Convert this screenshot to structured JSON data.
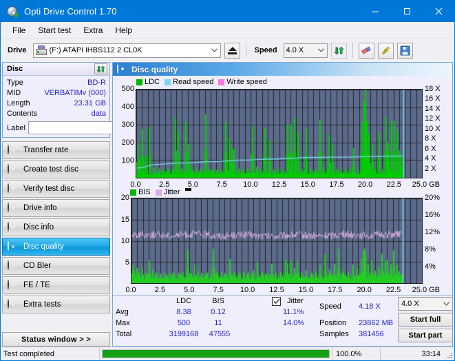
{
  "window": {
    "title": "Opti Drive Control 1.70",
    "icon": "disc-drive-icon",
    "minimize_label": "–",
    "maximize_label": "□",
    "close_label": "✕"
  },
  "menu": {
    "items": [
      {
        "label": "File",
        "name": "menu-file"
      },
      {
        "label": "Start test",
        "name": "menu-start-test"
      },
      {
        "label": "Extra",
        "name": "menu-extra"
      },
      {
        "label": "Help",
        "name": "menu-help"
      }
    ]
  },
  "toolbar": {
    "drive_label": "Drive",
    "drive_value": "(F:)  ATAPI iHBS112  2 CL0K",
    "eject_title": "Eject",
    "speed_label": "Speed",
    "speed_value": "4.0 X",
    "refresh_title": "Refresh",
    "erase_title": "Erase",
    "bitsetting_title": "Bitsetting",
    "save_title": "Save"
  },
  "sidebar": {
    "disc": {
      "title": "Disc",
      "refresh_title": "Refresh disc info",
      "rows": [
        {
          "key": "Type",
          "value": "BD-R"
        },
        {
          "key": "MID",
          "value": "VERBATIMv (000)"
        },
        {
          "key": "Length",
          "value": "23.31 GB"
        },
        {
          "key": "Contents",
          "value": "data"
        }
      ],
      "label_key": "Label",
      "label_value": "",
      "label_placeholder": "",
      "label_button_title": "Disc label"
    },
    "nav": [
      {
        "label": "Transfer rate",
        "name": "sidebar-item-transfer-rate",
        "active": false
      },
      {
        "label": "Create test disc",
        "name": "sidebar-item-create-test-disc",
        "active": false
      },
      {
        "label": "Verify test disc",
        "name": "sidebar-item-verify-test-disc",
        "active": false
      },
      {
        "label": "Drive info",
        "name": "sidebar-item-drive-info",
        "active": false
      },
      {
        "label": "Disc info",
        "name": "sidebar-item-disc-info",
        "active": false
      },
      {
        "label": "Disc quality",
        "name": "sidebar-item-disc-quality",
        "active": true
      },
      {
        "label": "CD Bler",
        "name": "sidebar-item-cd-bler",
        "active": false
      },
      {
        "label": "FE / TE",
        "name": "sidebar-item-fe-te",
        "active": false
      },
      {
        "label": "Extra tests",
        "name": "sidebar-item-extra-tests",
        "active": false
      }
    ],
    "status_window_label": "Status window > >"
  },
  "main": {
    "panel_title": "Disc quality",
    "stats": {
      "col_ldc": "LDC",
      "col_bis": "BIS",
      "row_avg": "Avg",
      "row_max": "Max",
      "row_total": "Total",
      "ldc_avg": "8.38",
      "ldc_max": "500",
      "ldc_total": "3199168",
      "bis_avg": "0.12",
      "bis_max": "11",
      "bis_total": "47555",
      "jitter_label": "Jitter",
      "jitter_checked": true,
      "jitter_avg": "11.1%",
      "jitter_max": "14.0%",
      "speed_label": "Speed",
      "speed_value": "4.18 X",
      "position_label": "Position",
      "position_value": "23862 MB",
      "samples_label": "Samples",
      "samples_value": "381456",
      "speed_select": "4.0 X",
      "start_full_label": "Start full",
      "start_part_label": "Start part"
    }
  },
  "statusbar": {
    "message": "Test completed",
    "progress_percent": 100.0,
    "progress_text": "100.0%",
    "elapsed": "33:14"
  },
  "colors": {
    "accent": "#0078d7",
    "plot_bg": "#5c6b8b",
    "grid": "#1e1e22",
    "ldc": "#00cc00",
    "bis": "#22cc22",
    "read_speed": "#7ad7f0",
    "write_speed": "#ff77dd",
    "jitter": "#d9aee0",
    "value_text": "#2222cc",
    "progress_fill": "#16a016"
  },
  "chart_data": [
    {
      "name": "ldc-chart",
      "type": "bar",
      "title": "",
      "legend": [
        {
          "label": "LDC",
          "color": "#00b400"
        },
        {
          "label": "Read speed",
          "color": "#7ad7f0"
        },
        {
          "label": "Write speed",
          "color": "#ff77dd"
        }
      ],
      "legend_position": "top-left",
      "grid": true,
      "xlabel": "GB",
      "xlim": [
        0.0,
        25.0
      ],
      "xticks": [
        "0.0",
        "2.5",
        "5.0",
        "7.5",
        "10.0",
        "12.5",
        "15.0",
        "17.5",
        "20.0",
        "22.5",
        "25.0"
      ],
      "xtickvals": [
        0.0,
        2.5,
        5.0,
        7.5,
        10.0,
        12.5,
        15.0,
        17.5,
        20.0,
        22.5,
        25.0
      ],
      "ylabel": "",
      "ylim": [
        0,
        500
      ],
      "yticks": [
        "100",
        "200",
        "300",
        "400",
        "500"
      ],
      "ytickvals": [
        100,
        200,
        300,
        400,
        500
      ],
      "y2label": "",
      "y2lim": [
        0,
        18
      ],
      "y2ticks": [
        "2 X",
        "4 X",
        "6 X",
        "8 X",
        "10 X",
        "12 X",
        "14 X",
        "16 X",
        "18 X"
      ],
      "y2tickvals": [
        2,
        4,
        6,
        8,
        10,
        12,
        14,
        16,
        18
      ],
      "series": [
        {
          "name": "LDC",
          "color": "#00cc00",
          "type": "spikes",
          "baseline": 28,
          "spikes": [
            [
              0.1,
              200
            ],
            [
              0.25,
              105
            ],
            [
              0.5,
              275
            ],
            [
              0.75,
              120
            ],
            [
              1.1,
              292
            ],
            [
              1.5,
              60
            ],
            [
              1.9,
              52
            ],
            [
              2.3,
              48
            ],
            [
              2.7,
              58
            ],
            [
              3.1,
              46
            ],
            [
              3.4,
              342
            ],
            [
              3.6,
              268
            ],
            [
              3.9,
              52
            ],
            [
              4.3,
              318
            ],
            [
              4.5,
              190
            ],
            [
              4.8,
              62
            ],
            [
              5.2,
              48
            ],
            [
              5.6,
              55
            ],
            [
              6.0,
              360
            ],
            [
              6.3,
              50
            ],
            [
              6.7,
              58
            ],
            [
              7.0,
              45
            ],
            [
              7.4,
              52
            ],
            [
              7.8,
              315
            ],
            [
              8.1,
              225
            ],
            [
              8.3,
              175
            ],
            [
              8.5,
              160
            ],
            [
              8.9,
              52
            ],
            [
              9.3,
              48
            ],
            [
              9.7,
              55
            ],
            [
              10.1,
              296
            ],
            [
              10.5,
              62
            ],
            [
              10.8,
              50
            ],
            [
              11.2,
              280
            ],
            [
              11.6,
              215
            ],
            [
              12.0,
              48
            ],
            [
              12.4,
              54
            ],
            [
              12.8,
              46
            ],
            [
              13.2,
              308
            ],
            [
              13.5,
              302
            ],
            [
              13.8,
              340
            ],
            [
              14.1,
              258
            ],
            [
              14.4,
              52
            ],
            [
              14.8,
              282
            ],
            [
              15.2,
              60
            ],
            [
              15.6,
              48
            ],
            [
              16.0,
              330
            ],
            [
              16.4,
              58
            ],
            [
              16.8,
              245
            ],
            [
              17.1,
              190
            ],
            [
              17.5,
              50
            ],
            [
              17.9,
              62
            ],
            [
              18.3,
              48
            ],
            [
              18.7,
              55
            ],
            [
              19.0,
              168
            ],
            [
              19.4,
              46
            ],
            [
              19.7,
              312
            ],
            [
              19.9,
              435
            ],
            [
              20.0,
              500
            ],
            [
              20.1,
              320
            ],
            [
              20.3,
              250
            ],
            [
              20.6,
              190
            ],
            [
              20.9,
              52
            ],
            [
              21.2,
              258
            ],
            [
              21.5,
              48
            ],
            [
              21.8,
              345
            ],
            [
              22.0,
              200
            ],
            [
              22.3,
              318
            ],
            [
              22.5,
              322
            ],
            [
              22.8,
              268
            ],
            [
              23.0,
              155
            ],
            [
              23.2,
              120
            ]
          ]
        },
        {
          "name": "Read speed",
          "color": "#7ad7f0",
          "type": "line",
          "axis": "y2",
          "points": [
            [
              0.05,
              2.0
            ],
            [
              0.6,
              2.1
            ],
            [
              1.2,
              2.5
            ],
            [
              1.6,
              2.7
            ],
            [
              2.4,
              2.8
            ],
            [
              3.0,
              2.9
            ],
            [
              3.6,
              3.0
            ],
            [
              4.4,
              3.0
            ],
            [
              5.0,
              3.1
            ],
            [
              5.6,
              3.2
            ],
            [
              6.2,
              3.3
            ],
            [
              7.0,
              3.3
            ],
            [
              7.6,
              3.4
            ],
            [
              8.4,
              3.5
            ],
            [
              9.0,
              3.6
            ],
            [
              9.8,
              3.6
            ],
            [
              10.6,
              3.7
            ],
            [
              11.4,
              3.8
            ],
            [
              12.2,
              3.8
            ],
            [
              13.0,
              3.9
            ],
            [
              13.8,
              4.0
            ],
            [
              14.4,
              4.1
            ],
            [
              15.0,
              4.15
            ],
            [
              16.0,
              4.15
            ],
            [
              17.0,
              4.2
            ],
            [
              18.0,
              4.2
            ],
            [
              19.0,
              4.25
            ],
            [
              20.0,
              4.3
            ],
            [
              21.0,
              4.35
            ],
            [
              22.0,
              4.4
            ],
            [
              23.0,
              4.4
            ],
            [
              23.35,
              4.45
            ]
          ]
        },
        {
          "name": "Write speed",
          "color": "#ff77dd",
          "type": "line",
          "axis": "y2",
          "points": []
        }
      ],
      "marker_line": {
        "x": 23.35,
        "color": "#7ad7f0"
      }
    },
    {
      "name": "bis-jitter-chart",
      "type": "bar",
      "title": "",
      "legend": [
        {
          "label": "BIS",
          "color": "#00b400"
        },
        {
          "label": "Jitter",
          "color": "#d9aee0"
        }
      ],
      "legend_position": "top-left",
      "grid": true,
      "xlabel": "GB",
      "xlim": [
        0.0,
        25.0
      ],
      "xticks": [
        "0.0",
        "2.5",
        "5.0",
        "7.5",
        "10.0",
        "12.5",
        "15.0",
        "17.5",
        "20.0",
        "22.5",
        "25.0"
      ],
      "xtickvals": [
        0.0,
        2.5,
        5.0,
        7.5,
        10.0,
        12.5,
        15.0,
        17.5,
        20.0,
        22.5,
        25.0
      ],
      "ylabel": "",
      "ylim": [
        0,
        20
      ],
      "yticks": [
        "5",
        "10",
        "15",
        "20"
      ],
      "ytickvals": [
        5,
        10,
        15,
        20
      ],
      "y2label": "",
      "y2lim": [
        0,
        20
      ],
      "y2ticks": [
        "4%",
        "8%",
        "12%",
        "16%",
        "20%"
      ],
      "y2tickvals": [
        4,
        8,
        12,
        16,
        20
      ],
      "series": [
        {
          "name": "BIS",
          "color": "#22cc22",
          "type": "spikes",
          "baseline": 1.6,
          "spikes": [
            [
              0.05,
              4.2
            ],
            [
              0.2,
              3.0
            ],
            [
              0.4,
              3.6
            ],
            [
              0.6,
              2.6
            ],
            [
              0.9,
              3.8
            ],
            [
              1.2,
              2.4
            ],
            [
              1.5,
              5.4
            ],
            [
              1.8,
              3.2
            ],
            [
              2.1,
              2.6
            ],
            [
              2.4,
              2.2
            ],
            [
              2.8,
              2.5
            ],
            [
              3.2,
              2.2
            ],
            [
              3.6,
              2.8
            ],
            [
              4.0,
              2.4
            ],
            [
              4.4,
              2.6
            ],
            [
              4.8,
              7.9
            ],
            [
              5.1,
              2.4
            ],
            [
              5.4,
              4.3
            ],
            [
              5.7,
              2.8
            ],
            [
              6.0,
              2.4
            ],
            [
              6.4,
              2.6
            ],
            [
              6.8,
              2.3
            ],
            [
              7.0,
              8.1
            ],
            [
              7.3,
              2.5
            ],
            [
              7.7,
              2.7
            ],
            [
              8.0,
              2.4
            ],
            [
              8.4,
              5.7
            ],
            [
              8.8,
              2.6
            ],
            [
              9.2,
              2.4
            ],
            [
              9.6,
              2.8
            ],
            [
              10.0,
              2.5
            ],
            [
              10.4,
              3.0
            ],
            [
              10.8,
              5.0
            ],
            [
              11.2,
              2.6
            ],
            [
              11.6,
              2.4
            ],
            [
              12.0,
              4.6
            ],
            [
              12.4,
              2.5
            ],
            [
              12.8,
              2.7
            ],
            [
              13.2,
              5.6
            ],
            [
              13.4,
              4.8
            ],
            [
              13.7,
              5.2
            ],
            [
              14.0,
              3.6
            ],
            [
              14.2,
              5.4
            ],
            [
              14.6,
              2.6
            ],
            [
              15.0,
              3.0
            ],
            [
              15.4,
              2.5
            ],
            [
              15.8,
              2.8
            ],
            [
              16.2,
              4.2
            ],
            [
              16.6,
              6.9
            ],
            [
              17.0,
              3.2
            ],
            [
              17.4,
              4.6
            ],
            [
              17.8,
              8.0
            ],
            [
              18.2,
              3.0
            ],
            [
              18.6,
              2.6
            ],
            [
              19.0,
              4.4
            ],
            [
              19.4,
              3.6
            ],
            [
              19.7,
              5.8
            ],
            [
              19.9,
              7.5
            ],
            [
              20.0,
              8.2
            ],
            [
              20.1,
              6.5
            ],
            [
              20.3,
              4.4
            ],
            [
              20.6,
              5.5
            ],
            [
              20.9,
              3.0
            ],
            [
              21.2,
              4.0
            ],
            [
              21.5,
              6.9
            ],
            [
              21.8,
              5.2
            ],
            [
              22.0,
              5.4
            ],
            [
              22.3,
              4.4
            ],
            [
              22.5,
              7.8
            ],
            [
              22.8,
              4.2
            ],
            [
              23.0,
              2.8
            ],
            [
              23.2,
              2.2
            ]
          ]
        },
        {
          "name": "Jitter",
          "color": "#d9aee0",
          "type": "noise-line",
          "axis": "y2",
          "mean": 11.3,
          "amplitude": 0.9,
          "x_start": 0.05,
          "x_end": 23.3
        }
      ],
      "marker_line": {
        "x": 23.35,
        "color": "#7ad7f0"
      }
    }
  ]
}
